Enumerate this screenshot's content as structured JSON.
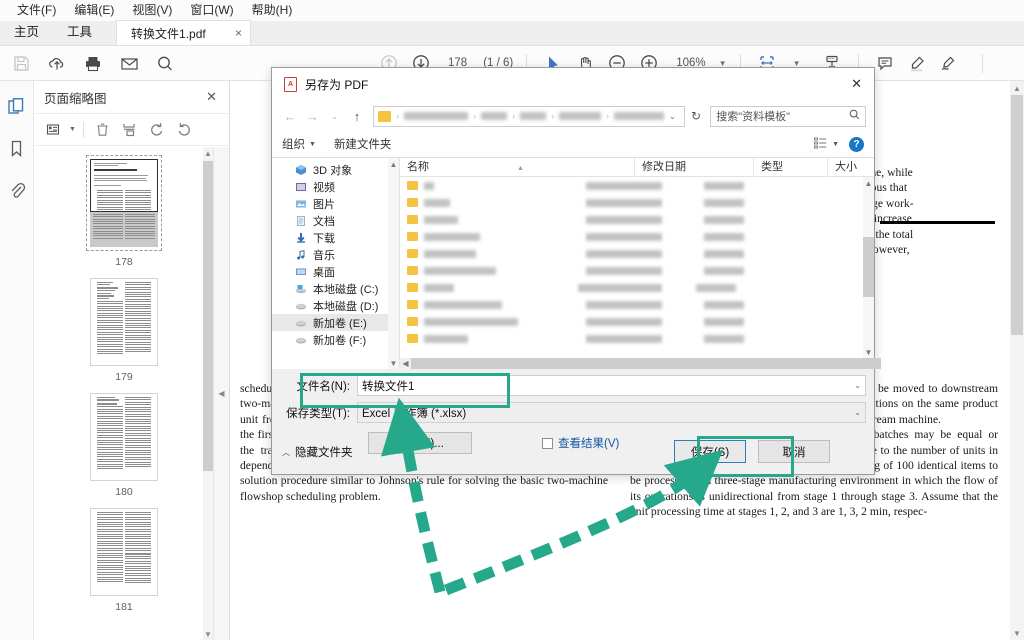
{
  "menubar": {
    "items": [
      {
        "label": "文件(F)",
        "name": "menu-file"
      },
      {
        "label": "编辑(E)",
        "name": "menu-edit"
      },
      {
        "label": "视图(V)",
        "name": "menu-view"
      },
      {
        "label": "窗口(W)",
        "name": "menu-window"
      },
      {
        "label": "帮助(H)",
        "name": "menu-help"
      }
    ]
  },
  "tabstrip": {
    "home": "主页",
    "tools": "工具",
    "document_tab": "转换文件1.pdf",
    "close_glyph": "×"
  },
  "toolbar": {
    "icons": [
      "save-icon",
      "upload-cloud-icon",
      "print-icon",
      "email-icon",
      "search-icon"
    ],
    "page_prev_icon": "arrow-up-circle-icon",
    "page_next_icon": "arrow-down-circle-icon",
    "page_number": "178",
    "page_total": "(1 / 6)",
    "select_icon": "cursor-arrow-icon",
    "hand_icon": "hand-icon",
    "zoom_out_icon": "minus-circle-icon",
    "zoom_in_icon": "plus-circle-icon",
    "zoom_value": "106%",
    "fit_icon": "fit-page-icon",
    "download_icon": "download-icon",
    "keyboard_icon": "keyboard-icon",
    "comment_icon": "comment-icon",
    "highlight_icon": "highlighter-icon",
    "sign_icon": "signature-icon"
  },
  "rail": {
    "items": [
      {
        "name": "page-thumbnails-icon",
        "label": "页面缩略图"
      },
      {
        "name": "bookmark-icon",
        "label": "书签"
      },
      {
        "name": "attachment-icon",
        "label": "附件"
      }
    ]
  },
  "thumbnail_panel": {
    "title": "页面缩略图",
    "close_glyph": "✕",
    "tools": [
      "list-view-icon",
      "delete-icon",
      "extract-pages-icon",
      "rotate-ccw-icon",
      "rotate-cw-icon"
    ],
    "pages": [
      {
        "label": "178",
        "selected": true
      },
      {
        "label": "179",
        "selected": false
      },
      {
        "label": "180",
        "selected": false
      },
      {
        "label": "181",
        "selected": false
      }
    ]
  },
  "document": {
    "left_column": "scheduling of multiple job lots with unit sized transfer batches is studied for a two-machine flow-line cell in which a single transport agent picks a completed unit from the first machine, delivers it to the second machine, and returns to the first machine. A completed unit on the first machine blocks the machine if the transport agent is in transit. We examine this problem for both unit dependent and independent setups on each machine, and propose an optimal solution procedure similar to Johnson's rule for solving the basic two-machine flowshop scheduling problem.",
    "right_column_p1": "the splitting of an entire lot into transfer batches to be moved to downstream machines permits the overlapping of different operations on the same product while work proceeds, to complete the lot on the upstream machine.",
    "right_column_p2": "There are many ways to split a lot: transfer batches may be equal or unequal, with the number of splits ranging from one to the number of units in the job lot. For instance, consider a job lot consisting of 100 identical items to be processed in a three-stage manufacturing environment in which the flow of its operations is unidirectional from stage 1 through stage 3. Assume that the unit processing time at stages 1, 2, and 3 are 1, 3, 2 min, respec-",
    "right_top_lines": [
      "machine, while",
      "e obvious that",
      "l to large work-",
      "l to an increase",
      "hich is the total",
      "lots. However,"
    ]
  },
  "dialog": {
    "title": "另存为 PDF",
    "close_glyph": "✕",
    "nav": {
      "back_glyph": "←",
      "forward_glyph": "→",
      "recent_glyph": "⌄",
      "up_glyph": "↑",
      "refresh_glyph": "↻",
      "breadcrumb_redacted": true
    },
    "search_placeholder": "搜索\"资料模板\"",
    "search_icon": "search-icon",
    "commands": {
      "organize": "组织",
      "new_folder": "新建文件夹",
      "view_icon": "view-layout-icon",
      "help_glyph": "?"
    },
    "nav_pane": [
      {
        "label": "3D 对象",
        "icon": "3d-objects-icon",
        "selected": false
      },
      {
        "label": "视频",
        "icon": "videos-icon",
        "selected": false
      },
      {
        "label": "图片",
        "icon": "pictures-icon",
        "selected": false
      },
      {
        "label": "文档",
        "icon": "documents-icon",
        "selected": false
      },
      {
        "label": "下载",
        "icon": "downloads-icon",
        "selected": false
      },
      {
        "label": "音乐",
        "icon": "music-icon",
        "selected": false
      },
      {
        "label": "桌面",
        "icon": "desktop-icon",
        "selected": false
      },
      {
        "label": "本地磁盘 (C:)",
        "icon": "windows-drive-icon",
        "selected": false
      },
      {
        "label": "本地磁盘 (D:)",
        "icon": "drive-icon",
        "selected": false
      },
      {
        "label": "新加卷 (E:)",
        "icon": "drive-icon",
        "selected": true
      },
      {
        "label": "新加卷 (F:)",
        "icon": "drive-icon",
        "selected": false
      }
    ],
    "file_columns": [
      "名称",
      "修改日期",
      "类型",
      "大小"
    ],
    "file_rows_redacted_count": 10,
    "filename_label": "文件名(N):",
    "filename_value": "转换文件1",
    "savetype_label": "保存类型(T):",
    "savetype_value": "Excel 工作簿 (*.xlsx)",
    "settings_button": "设置(E)...",
    "view_result_checkbox": "查看结果(V)",
    "hide_folders": "隐藏文件夹",
    "save_button": "保存(S)",
    "cancel_button": "取消"
  },
  "annotations": {
    "highlight_color": "#25a98a",
    "highlight_targets": [
      "savetype-row",
      "save-button"
    ],
    "arrows": 2
  }
}
